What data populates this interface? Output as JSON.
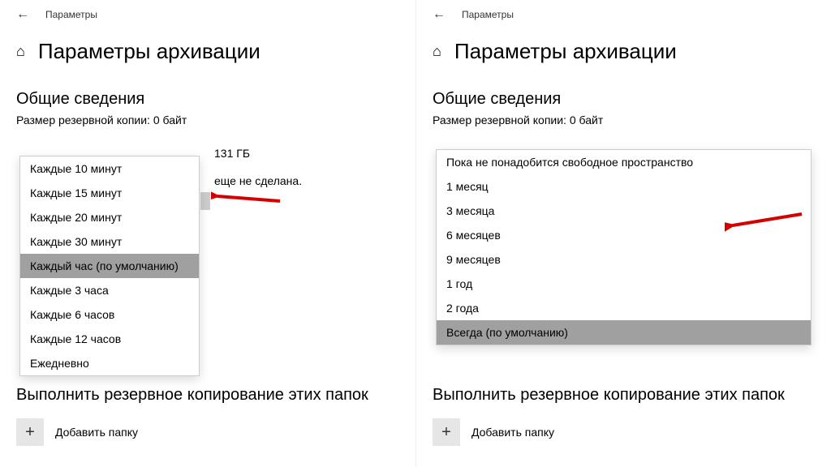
{
  "titlebar_label": "Параметры",
  "page_title": "Параметры архивации",
  "section_overview": "Общие сведения",
  "backup_size_line": "Размер резервной копии: 0 байт",
  "left": {
    "frag_storage_suffix": "131 ГБ",
    "frag_status_suffix": "еще не сделана.",
    "frag_below_dropdown": "Выполнить резервное копирование этих папок",
    "add_folder": "Добавить папку",
    "dropdown": [
      "Каждые 10 минут",
      "Каждые 15 минут",
      "Каждые 20 минут",
      "Каждые 30 минут",
      "Каждый час (по умолчанию)",
      "Каждые 3 часа",
      "Каждые 6 часов",
      "Каждые 12 часов",
      "Ежедневно"
    ],
    "dropdown_selected_index": 4
  },
  "right": {
    "section_folders": "Выполнить резервное копирование этих папок",
    "add_folder": "Добавить папку",
    "dropdown": [
      "Пока не понадобится свободное пространство",
      "1 месяц",
      "3 месяца",
      "6 месяцев",
      "9 месяцев",
      "1 год",
      "2 года",
      "Всегда (по умолчанию)"
    ],
    "dropdown_selected_index": 7
  },
  "arrow_color": "#d40000"
}
